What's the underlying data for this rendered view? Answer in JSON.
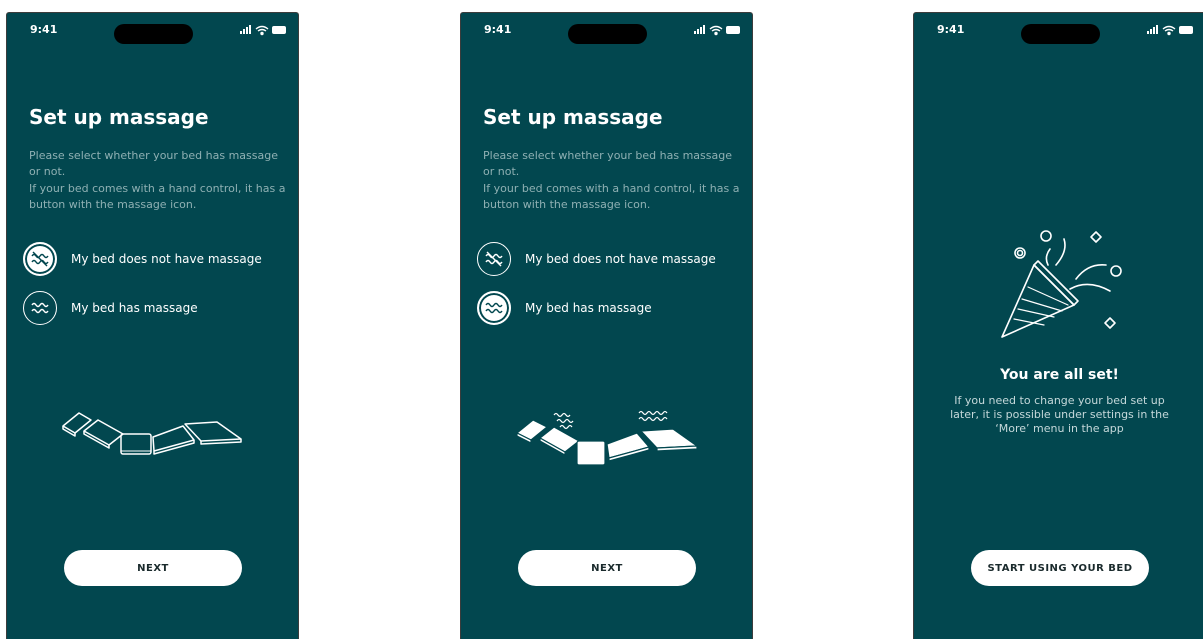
{
  "status_bar": {
    "time": "9:41"
  },
  "screens": [
    {
      "title": "Set up massage",
      "description": [
        "Please select whether your bed has massage or not.",
        "If your bed comes with a hand control, it has a button with the massage icon."
      ],
      "options": [
        {
          "label": "My bed does not have massage",
          "icon": "no-massage-icon",
          "selected": true
        },
        {
          "label": "My bed has massage",
          "icon": "massage-icon",
          "selected": false
        }
      ],
      "button": "NEXT"
    },
    {
      "title": "Set up massage",
      "description": [
        "Please select whether your bed has massage or not.",
        "If your bed comes with a hand control, it has a button with the massage icon."
      ],
      "options": [
        {
          "label": "My bed does not have massage",
          "icon": "no-massage-icon",
          "selected": false
        },
        {
          "label": "My bed has massage",
          "icon": "massage-icon",
          "selected": true
        }
      ],
      "button": "NEXT"
    },
    {
      "title": "You are all set!",
      "description": "If you need to change your bed set up later, it is possible under settings in the ‘More’ menu in the app",
      "icon": "party-popper-icon",
      "button": "START USING YOUR BED"
    }
  ],
  "colors": {
    "background": "#02474f",
    "button": "#ffffff",
    "description": "#8fb0b3"
  }
}
